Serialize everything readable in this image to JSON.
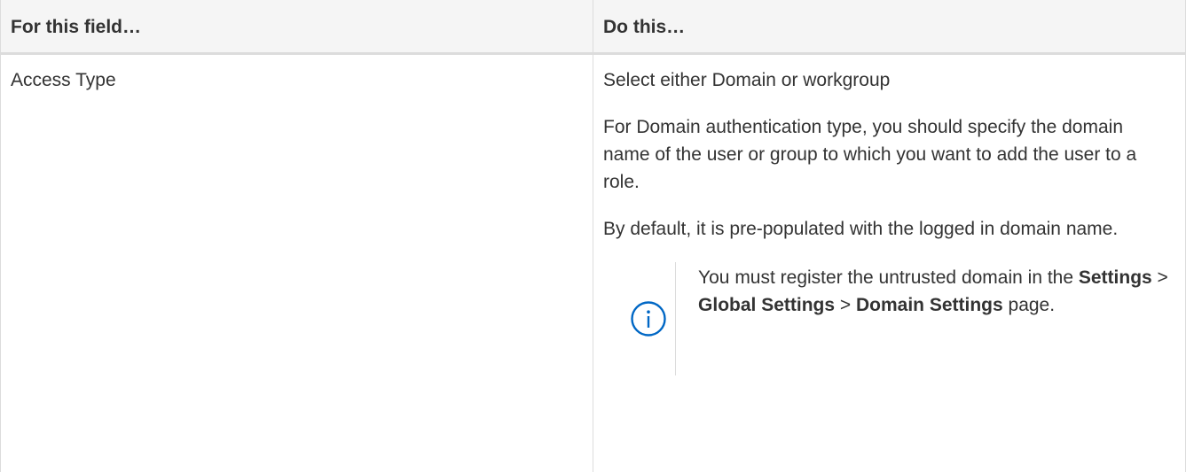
{
  "table": {
    "headers": [
      "For this field…",
      "Do this…"
    ],
    "row": {
      "field": "Access Type",
      "paragraphs": [
        "Select either Domain or workgroup",
        "For Domain authentication type, you should specify the domain name of the user or group to which you want to add the user to a role.",
        "By default, it is pre-populated with the logged in domain name."
      ],
      "note": {
        "icon": "info-circle-icon",
        "prefix": "You must register the untrusted domain in the ",
        "path": [
          "Settings",
          "Global Settings",
          "Domain Settings"
        ],
        "separator": " > ",
        "suffix": " page."
      }
    }
  },
  "colors": {
    "border": "#dcdcdc",
    "header_bg": "#f5f5f5",
    "text": "#333333",
    "icon": "#0067c5"
  }
}
